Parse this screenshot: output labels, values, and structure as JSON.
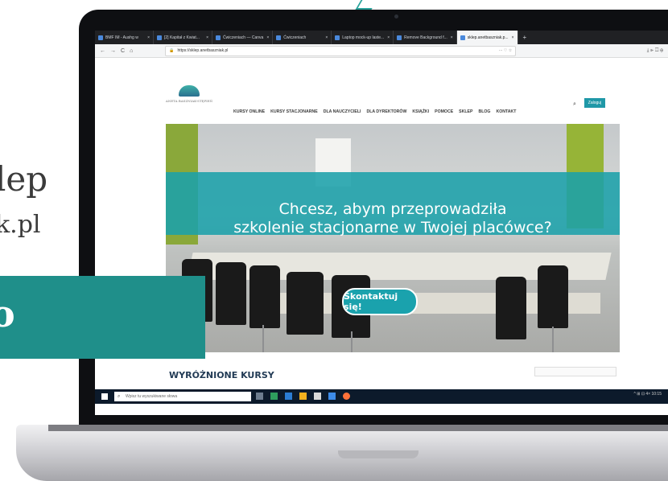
{
  "promo": {
    "line1": "lep",
    "line2": "k.pl",
    "box_glyph": "o"
  },
  "browser": {
    "tabs": [
      {
        "label": "BMF IM - Aushg w"
      },
      {
        "label": "[2] Kapitał z Kwiat..."
      },
      {
        "label": "Ćwiczeniach — Canva"
      },
      {
        "label": "Ćwiczeniach"
      },
      {
        "label": "Laptop mock-up laste..."
      },
      {
        "label": "Remove Background f..."
      },
      {
        "label": "sklep.anetbaszniak.p..."
      }
    ],
    "new_tab": "+",
    "nav": {
      "back": "←",
      "forward": "→",
      "reload": "C",
      "home": "⌂"
    },
    "url": "https://sklep.anetbaszniak.pl",
    "url_actions": "··· ♡ ☆",
    "tools": "⤓  ⊪  ◫  ⊕"
  },
  "site": {
    "logo_name": "ANETA BASZNIAK-STĘPIEŃ",
    "menu": [
      "KURSY ONLINE",
      "KURSY STACJONARNE",
      "DLA NAUCZYCIELI",
      "DLA DYREKTORÓW",
      "KSIĄŻKI",
      "POMOCE",
      "SKLEP",
      "BLOG",
      "KONTAKT"
    ],
    "login_label": "Zaloguj",
    "banner_line1": "Chcesz, abym przeprowadziła",
    "banner_line2": "szkolenie stacjonarne w Twojej placówce?",
    "cta_label": "Skontaktuj się!",
    "section_title": "WYRÓŻNIONE KURSY"
  },
  "taskbar": {
    "search_placeholder": "Wpisz tu wyszukiwane słowa",
    "tray": "^ ⊞ ⊡ 4× 10:15"
  },
  "colors": {
    "teal": "#1f8f8a",
    "banner": "#1ba0aa",
    "taskbar": "#0c1a2b"
  }
}
